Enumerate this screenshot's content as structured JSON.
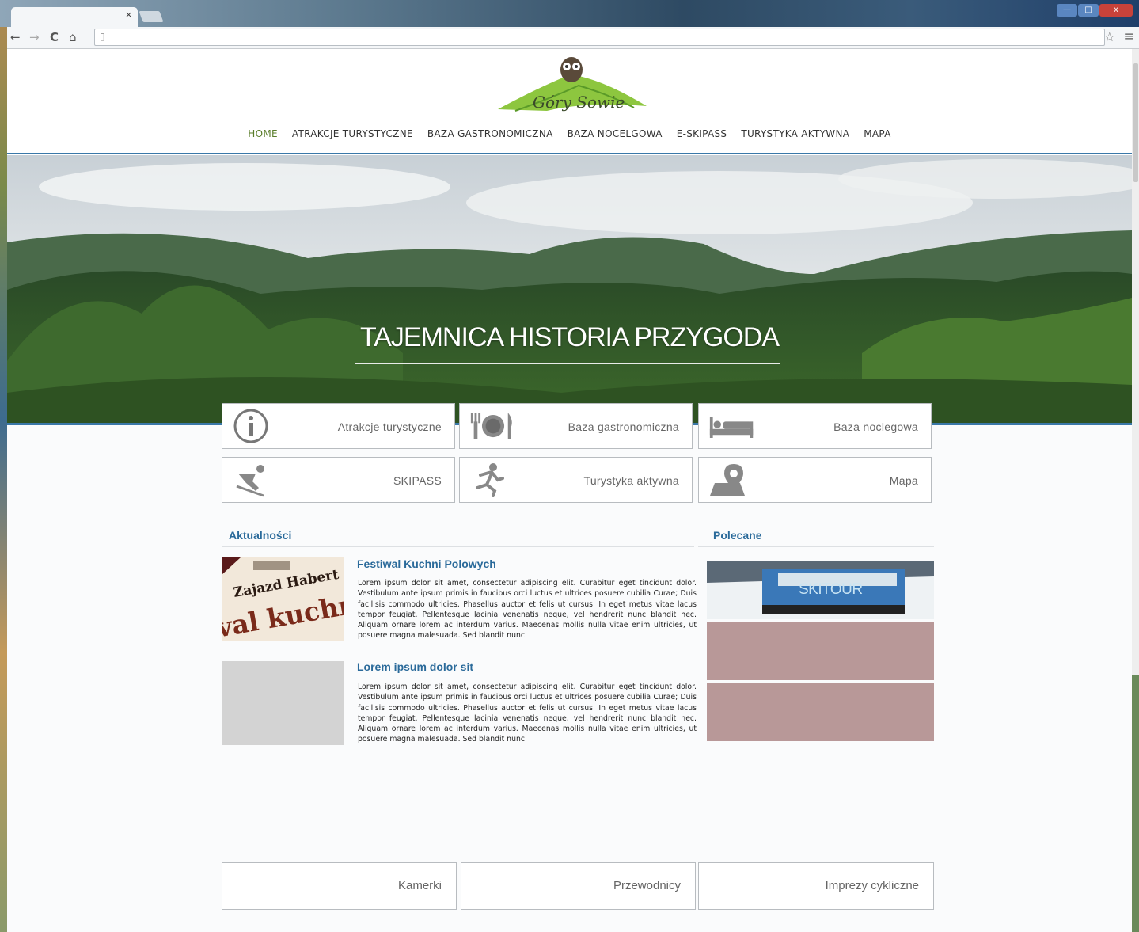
{
  "browser": {
    "tab_close": "×",
    "address": "",
    "nav_back": "←",
    "nav_forward": "→",
    "reload": "C",
    "home": "⌂",
    "star": "☆",
    "menu": "≡",
    "win_min": "—",
    "win_max": "□",
    "win_close": "x"
  },
  "site": {
    "logo_text": "Góry Sowie",
    "nav": [
      {
        "label": "HOME",
        "active": true
      },
      {
        "label": "ATRAKCJE TURYSTYCZNE"
      },
      {
        "label": "BAZA GASTRONOMICZNA"
      },
      {
        "label": "BAZA NOCELGOWA"
      },
      {
        "label": "E-SKIPASS"
      },
      {
        "label": "TURYSTYKA AKTYWNA"
      },
      {
        "label": "MAPA"
      }
    ],
    "hero_title": "TAJEMNICA HISTORIA PRZYGODA"
  },
  "tiles": [
    {
      "label": "Atrakcje turystyczne",
      "icon": "info-icon"
    },
    {
      "label": "Baza gastronomiczna",
      "icon": "plate-icon"
    },
    {
      "label": "Baza noclegowa",
      "icon": "bed-icon"
    },
    {
      "label": "SKIPASS",
      "icon": "skier-icon"
    },
    {
      "label": "Turystyka aktywna",
      "icon": "runner-icon"
    },
    {
      "label": "Mapa",
      "icon": "map-pin-icon"
    }
  ],
  "news": {
    "heading": "Aktualności",
    "items": [
      {
        "title": "Festiwal Kuchni Polowych",
        "text": "Lorem ipsum dolor sit amet, consectetur adipiscing elit. Curabitur eget tincidunt dolor. Vestibulum ante ipsum primis in faucibus orci luctus et ultrices posuere cubilia Curae; Duis facilisis commodo ultricies. Phasellus auctor et felis ut cursus. In eget metus vitae lacus tempor feugiat. Pellentesque lacinia venenatis neque, vel hendrerit nunc blandit nec. Aliquam ornare lorem ac interdum varius. Maecenas mollis nulla vitae enim ultricies, ut posuere magna malesuada. Sed blandit nunc",
        "image_text_1": "Zajazd Habert",
        "image_text_2": "val kuchni po"
      },
      {
        "title": "Lorem ipsum dolor sit",
        "text": "Lorem ipsum dolor sit amet, consectetur adipiscing elit. Curabitur eget tincidunt dolor. Vestibulum ante ipsum primis in faucibus orci luctus et ultrices posuere cubilia Curae; Duis facilisis commodo ultricies. Phasellus auctor et felis ut cursus. In eget metus vitae lacus tempor feugiat. Pellentesque lacinia venenatis neque, vel hendrerit nunc blandit nec. Aliquam ornare lorem ac interdum varius. Maecenas mollis nulla vitae enim ultricies, ut posuere magna malesuada. Sed blandit nunc"
      }
    ]
  },
  "recommended": {
    "heading": "Polecane",
    "banner_label": "SKITOUR",
    "placeholder_color": "#b89898"
  },
  "bottom_tiles": [
    {
      "label": "Kamerki"
    },
    {
      "label": "Przewodnicy"
    },
    {
      "label": "Imprezy cykliczne"
    }
  ],
  "colors": {
    "accent": "#2a6a9a",
    "nav_active": "#5a7d2a",
    "rule": "#3a78a8"
  }
}
